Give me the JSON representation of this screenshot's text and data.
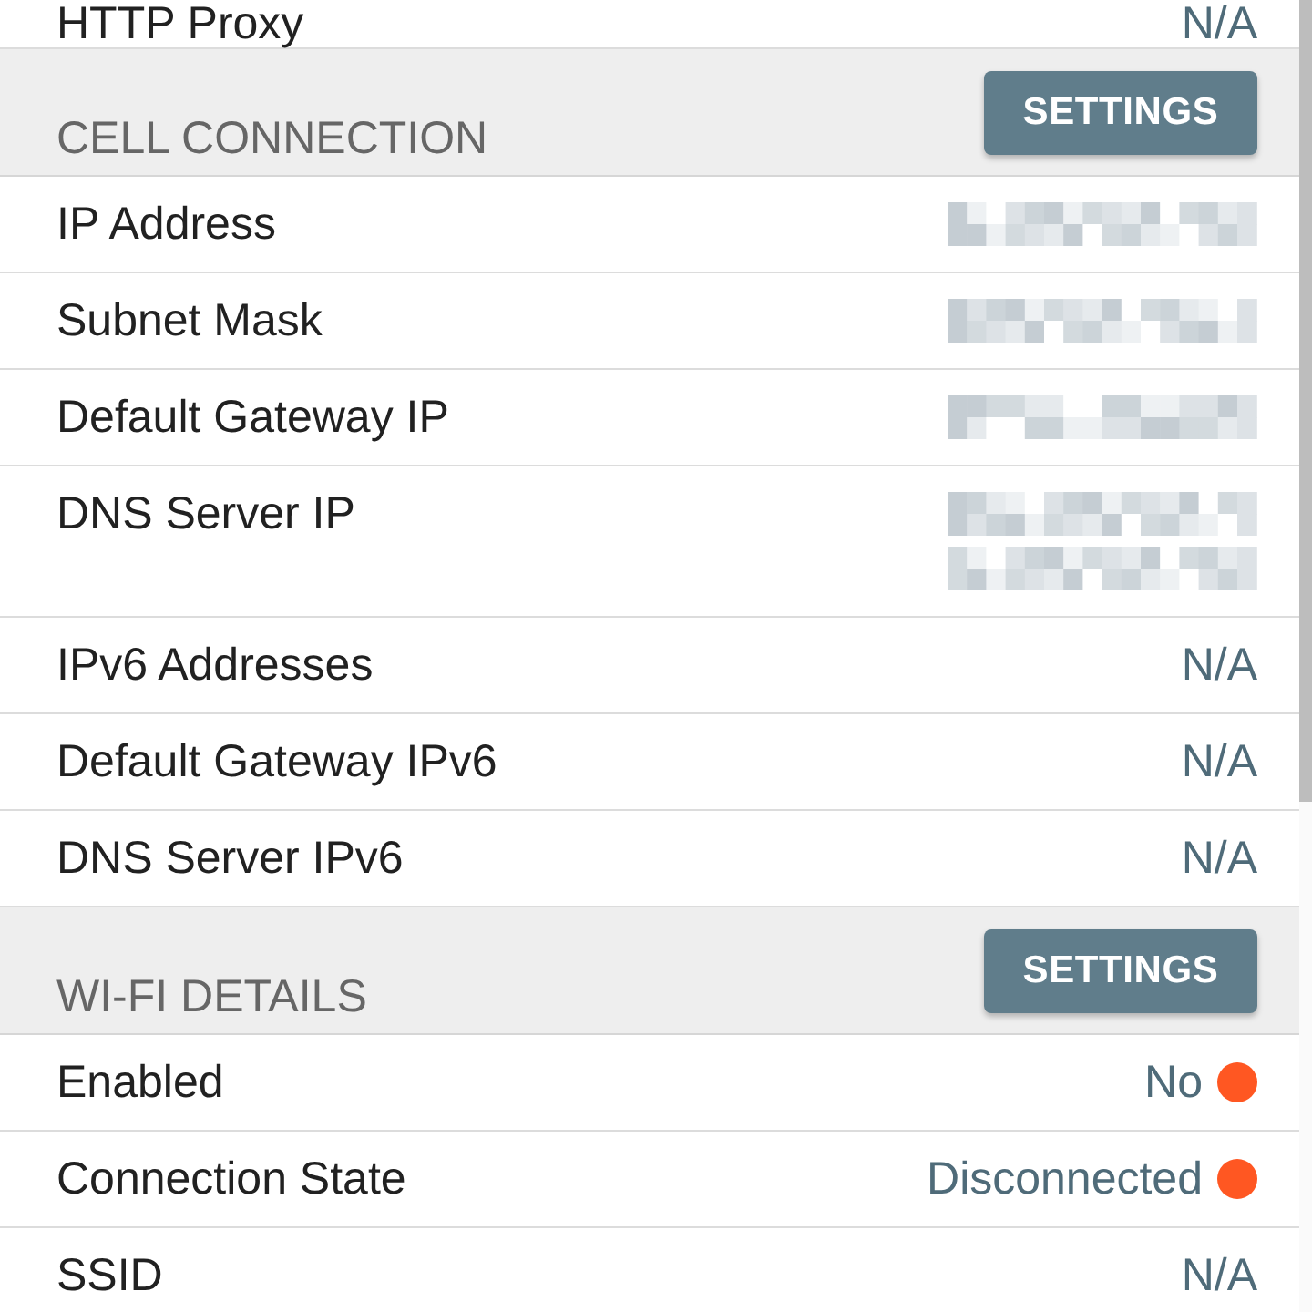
{
  "sections": [
    {
      "rows": [
        {
          "label": "HTTP Proxy",
          "values": [
            {
              "kind": "text",
              "text": "N/A"
            }
          ]
        }
      ]
    },
    {
      "title": "CELL CONNECTION",
      "button": "SETTINGS",
      "rows": [
        {
          "label": "IP Address",
          "values": [
            {
              "kind": "redacted"
            }
          ]
        },
        {
          "label": "Subnet Mask",
          "values": [
            {
              "kind": "redacted"
            }
          ]
        },
        {
          "label": "Default Gateway IP",
          "values": [
            {
              "kind": "redacted"
            }
          ]
        },
        {
          "label": "DNS Server IP",
          "values": [
            {
              "kind": "redacted"
            },
            {
              "kind": "redacted"
            }
          ]
        },
        {
          "label": "IPv6 Addresses",
          "values": [
            {
              "kind": "text",
              "text": "N/A"
            }
          ]
        },
        {
          "label": "Default Gateway IPv6",
          "values": [
            {
              "kind": "text",
              "text": "N/A"
            }
          ]
        },
        {
          "label": "DNS Server IPv6",
          "values": [
            {
              "kind": "text",
              "text": "N/A"
            }
          ]
        }
      ]
    },
    {
      "title": "WI-FI DETAILS",
      "button": "SETTINGS",
      "rows": [
        {
          "label": "Enabled",
          "values": [
            {
              "kind": "status",
              "text": "No",
              "color": "#ff5722"
            }
          ]
        },
        {
          "label": "Connection State",
          "values": [
            {
              "kind": "status",
              "text": "Disconnected",
              "color": "#ff5722"
            }
          ]
        },
        {
          "label": "SSID",
          "values": [
            {
              "kind": "text",
              "text": "N/A"
            }
          ]
        }
      ]
    }
  ]
}
